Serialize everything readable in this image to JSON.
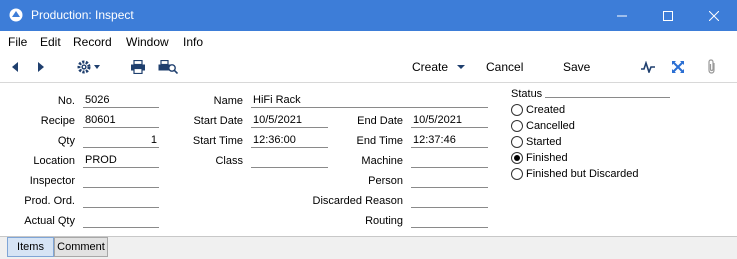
{
  "window": {
    "title": "Production: Inspect"
  },
  "menu": [
    "File",
    "Edit",
    "Record",
    "Window",
    "Info"
  ],
  "toolbar": {
    "create_label": "Create",
    "cancel_label": "Cancel",
    "save_label": "Save"
  },
  "fields": {
    "no": {
      "label": "No.",
      "value": "5026"
    },
    "recipe": {
      "label": "Recipe",
      "value": "80601"
    },
    "qty": {
      "label": "Qty",
      "value": "1"
    },
    "location": {
      "label": "Location",
      "value": "PROD"
    },
    "inspector": {
      "label": "Inspector",
      "value": ""
    },
    "prod_ord": {
      "label": "Prod. Ord.",
      "value": ""
    },
    "actual_qty": {
      "label": "Actual Qty",
      "value": ""
    },
    "name": {
      "label": "Name",
      "value": "HiFi Rack"
    },
    "start_date": {
      "label": "Start Date",
      "value": "10/5/2021"
    },
    "start_time": {
      "label": "Start Time",
      "value": "12:36:00"
    },
    "class": {
      "label": "Class",
      "value": ""
    },
    "end_date": {
      "label": "End Date",
      "value": "10/5/2021"
    },
    "end_time": {
      "label": "End Time",
      "value": "12:37:46"
    },
    "machine": {
      "label": "Machine",
      "value": ""
    },
    "person": {
      "label": "Person",
      "value": ""
    },
    "discarded_reason": {
      "label": "Discarded Reason",
      "value": ""
    },
    "routing": {
      "label": "Routing",
      "value": ""
    }
  },
  "status": {
    "label": "Status",
    "options": [
      "Created",
      "Cancelled",
      "Started",
      "Finished",
      "Finished but Discarded"
    ],
    "selected": "Finished"
  },
  "tabs": [
    "Items",
    "Comment"
  ],
  "colors": {
    "titlebar": "#3d7dd8",
    "active_tab": "#d6e4f5"
  }
}
